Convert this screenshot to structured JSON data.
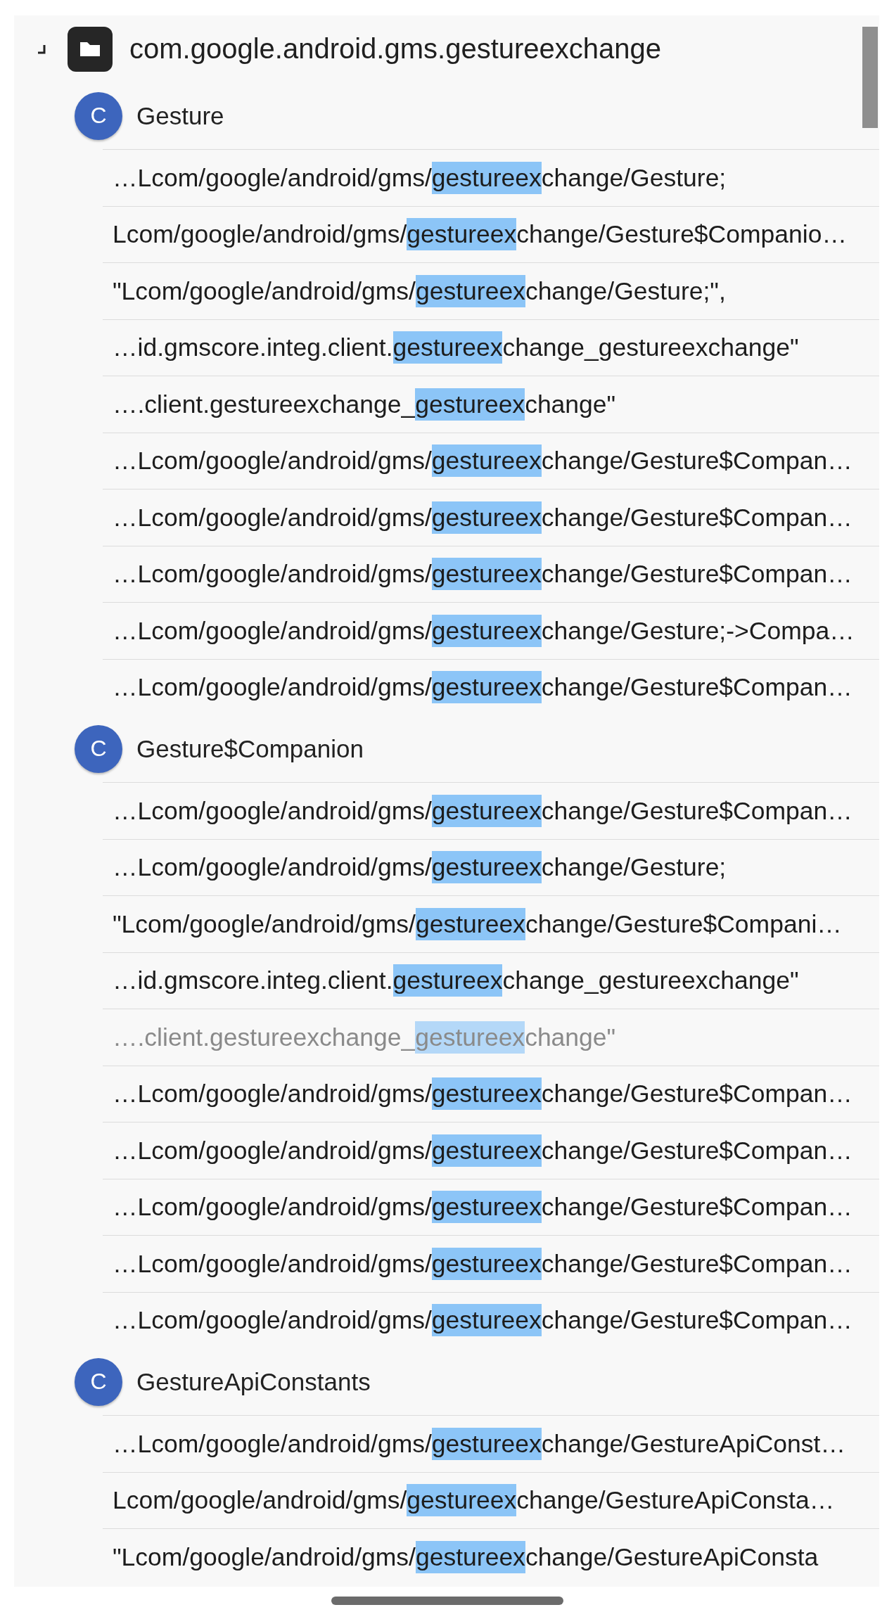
{
  "package": {
    "name": "com.google.android.gms.gestureexchange"
  },
  "classes": [
    {
      "badge": "C",
      "name": "Gesture",
      "results": [
        {
          "before": "…Lcom/google/android/gms/",
          "match": "gestureex",
          "after": "change/Gesture;",
          "dimmed": false
        },
        {
          "before": "Lcom/google/android/gms/",
          "match": "gestureex",
          "after": "change/Gesture$Companio…",
          "dimmed": false
        },
        {
          "before": "\"Lcom/google/android/gms/",
          "match": "gestureex",
          "after": "change/Gesture;\",",
          "dimmed": false
        },
        {
          "before": "…id.gmscore.integ.client.",
          "match": "gestureex",
          "after": "change_gestureexchange\"",
          "dimmed": false
        },
        {
          "before": "….client.gestureexchange_",
          "match": "gestureex",
          "after": "change\"",
          "dimmed": false
        },
        {
          "before": "…Lcom/google/android/gms/",
          "match": "gestureex",
          "after": "change/Gesture$Compan…",
          "dimmed": false
        },
        {
          "before": "…Lcom/google/android/gms/",
          "match": "gestureex",
          "after": "change/Gesture$Compan…",
          "dimmed": false
        },
        {
          "before": "…Lcom/google/android/gms/",
          "match": "gestureex",
          "after": "change/Gesture$Compan…",
          "dimmed": false
        },
        {
          "before": "…Lcom/google/android/gms/",
          "match": "gestureex",
          "after": "change/Gesture;->Compa…",
          "dimmed": false
        },
        {
          "before": "…Lcom/google/android/gms/",
          "match": "gestureex",
          "after": "change/Gesture$Compan…",
          "dimmed": false
        }
      ]
    },
    {
      "badge": "C",
      "name": "Gesture$Companion",
      "results": [
        {
          "before": "…Lcom/google/android/gms/",
          "match": "gestureex",
          "after": "change/Gesture$Compan…",
          "dimmed": false
        },
        {
          "before": "…Lcom/google/android/gms/",
          "match": "gestureex",
          "after": "change/Gesture;",
          "dimmed": false
        },
        {
          "before": "\"Lcom/google/android/gms/",
          "match": "gestureex",
          "after": "change/Gesture$Compani…",
          "dimmed": false
        },
        {
          "before": "…id.gmscore.integ.client.",
          "match": "gestureex",
          "after": "change_gestureexchange\"",
          "dimmed": false
        },
        {
          "before": "….client.gestureexchange_",
          "match": "gestureex",
          "after": "change\"",
          "dimmed": true
        },
        {
          "before": "…Lcom/google/android/gms/",
          "match": "gestureex",
          "after": "change/Gesture$Compan…",
          "dimmed": false
        },
        {
          "before": "…Lcom/google/android/gms/",
          "match": "gestureex",
          "after": "change/Gesture$Compan…",
          "dimmed": false
        },
        {
          "before": "…Lcom/google/android/gms/",
          "match": "gestureex",
          "after": "change/Gesture$Compan…",
          "dimmed": false
        },
        {
          "before": "…Lcom/google/android/gms/",
          "match": "gestureex",
          "after": "change/Gesture$Compan…",
          "dimmed": false
        },
        {
          "before": "…Lcom/google/android/gms/",
          "match": "gestureex",
          "after": "change/Gesture$Compan…",
          "dimmed": false
        }
      ]
    },
    {
      "badge": "C",
      "name": "GestureApiConstants",
      "results": [
        {
          "before": "…Lcom/google/android/gms/",
          "match": "gestureex",
          "after": "change/GestureApiConst…",
          "dimmed": false
        },
        {
          "before": "Lcom/google/android/gms/",
          "match": "gestureex",
          "after": "change/GestureApiConsta…",
          "dimmed": false
        },
        {
          "before": "\"Lcom/google/android/gms/",
          "match": "gestureex",
          "after": "change/GestureApiConsta",
          "dimmed": false
        }
      ]
    }
  ]
}
